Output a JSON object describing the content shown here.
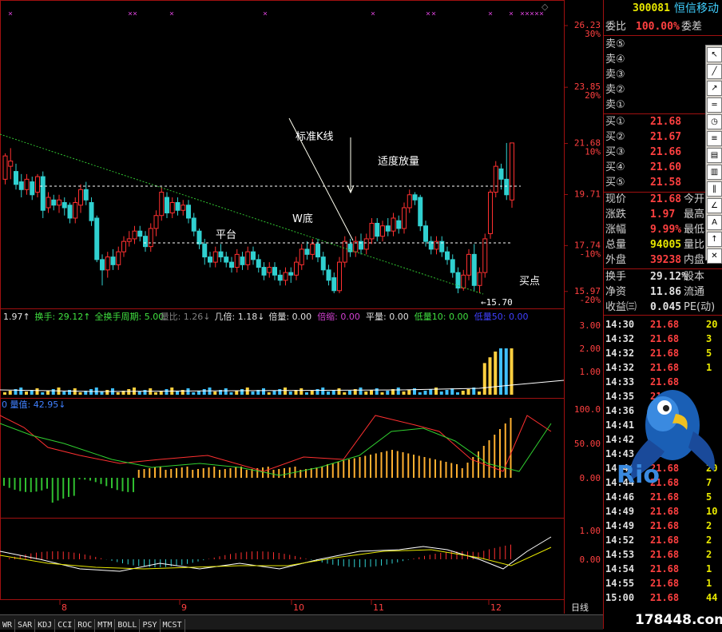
{
  "stock": {
    "code": "300081",
    "name": "恒信移动"
  },
  "order_book": {
    "weibi_label": "委比",
    "weibi_value": "100.00%",
    "weicha_label": "委差",
    "asks": [
      {
        "label": "卖⑤",
        "price": "",
        "vol": ""
      },
      {
        "label": "卖④",
        "price": "",
        "vol": ""
      },
      {
        "label": "卖③",
        "price": "",
        "vol": ""
      },
      {
        "label": "卖②",
        "price": "",
        "vol": ""
      },
      {
        "label": "卖①",
        "price": "",
        "vol": ""
      }
    ],
    "bids": [
      {
        "label": "买①",
        "price": "21.68"
      },
      {
        "label": "买②",
        "price": "21.67"
      },
      {
        "label": "买③",
        "price": "21.66"
      },
      {
        "label": "买④",
        "price": "21.60"
      },
      {
        "label": "买⑤",
        "price": "21.58"
      }
    ]
  },
  "stats": [
    {
      "label": "现价",
      "value": "21.68",
      "label2": "今开",
      "color": "red"
    },
    {
      "label": "涨跌",
      "value": "1.97",
      "label2": "最高",
      "color": "red"
    },
    {
      "label": "涨幅",
      "value": "9.99%",
      "label2": "最低",
      "color": "red"
    },
    {
      "label": "总量",
      "value": "94005",
      "label2": "量比",
      "color": "yel"
    },
    {
      "label": "外盘",
      "value": "39238",
      "label2": "内盘",
      "color": "red"
    },
    {
      "label": "换手",
      "value": "29.12%",
      "label2": "股本",
      "color": "wht"
    },
    {
      "label": "净资",
      "value": "11.86",
      "label2": "流通",
      "color": "wht"
    },
    {
      "label": "收益㈢",
      "value": "0.045",
      "label2": "PE(动)",
      "color": "wht"
    }
  ],
  "ticks": [
    {
      "time": "14:30",
      "price": "21.68",
      "vol": "20"
    },
    {
      "time": "14:32",
      "price": "21.68",
      "vol": "3"
    },
    {
      "time": "14:32",
      "price": "21.68",
      "vol": "5"
    },
    {
      "time": "14:32",
      "price": "21.68",
      "vol": "1"
    },
    {
      "time": "14:33",
      "price": "21.68",
      "vol": ""
    },
    {
      "time": "14:35",
      "price": "21.6",
      "vol": ""
    },
    {
      "time": "14:36",
      "price": "21.68",
      "vol": ""
    },
    {
      "time": "14:41",
      "price": "21.68",
      "vol": ""
    },
    {
      "time": "14:42",
      "price": "21.68",
      "vol": ""
    },
    {
      "time": "14:43",
      "price": "21.68",
      "vol": ""
    },
    {
      "time": "14:44",
      "price": "21.68",
      "vol": "20"
    },
    {
      "time": "14:44",
      "price": "21.68",
      "vol": "7"
    },
    {
      "time": "14:46",
      "price": "21.68",
      "vol": "5"
    },
    {
      "time": "14:49",
      "price": "21.68",
      "vol": "10"
    },
    {
      "time": "14:49",
      "price": "21.68",
      "vol": "2"
    },
    {
      "time": "14:52",
      "price": "21.68",
      "vol": "2"
    },
    {
      "time": "14:53",
      "price": "21.68",
      "vol": "2"
    },
    {
      "time": "14:54",
      "price": "21.68",
      "vol": "1"
    },
    {
      "time": "14:55",
      "price": "21.68",
      "vol": "1"
    },
    {
      "time": "15:00",
      "price": "21.68",
      "vol": "44"
    }
  ],
  "price_axis": [
    {
      "price": "26.23",
      "pct": "30%"
    },
    {
      "price": "23.85",
      "pct": "20%"
    },
    {
      "price": "21.68",
      "pct": "10%"
    },
    {
      "price": "19.71",
      "pct": ""
    },
    {
      "price": "17.74",
      "pct": "-10%"
    },
    {
      "price": "15.97",
      "pct": "-20%"
    }
  ],
  "annotations": {
    "standard_k": "标准K线",
    "moderate_vol": "适度放量",
    "w_bottom": "W底",
    "platform": "平台",
    "buy_point": "买点",
    "low_mark": "←15.70"
  },
  "vol_indicator": [
    {
      "text": "1.97↑",
      "color": "#e0e0e0"
    },
    {
      "text": "换手: 29.12↑",
      "color": "#40e040"
    },
    {
      "text": "全换手周期: 5.00",
      "color": "#40e040"
    },
    {
      "text": "量比: 1.26↓",
      "color": "#808080"
    },
    {
      "text": "几倍: 1.18↓",
      "color": "#e0e0e0"
    },
    {
      "text": "倍量: 0.00",
      "color": "#e0e0e0"
    },
    {
      "text": "倍缩: 0.00",
      "color": "#d040d0"
    },
    {
      "text": "平量: 0.00",
      "color": "#e0e0e0"
    },
    {
      "text": "低量10: 0.00",
      "color": "#40e040"
    },
    {
      "text": "低量50: 0.00",
      "color": "#4040ff"
    }
  ],
  "vol_axis": [
    "3.00",
    "2.00",
    "1.00"
  ],
  "ind2_label": "0 量值: 42.95↓",
  "ind2_axis": [
    "100.0",
    "50.00",
    "0.00"
  ],
  "ind3_axis": [
    "1.00",
    "0.00"
  ],
  "months": [
    "8",
    "9",
    "10",
    "11",
    "12"
  ],
  "period": "日线",
  "nav": [
    "+",
    "-",
    "0"
  ],
  "tabs": [
    "WR",
    "SAR",
    "KDJ",
    "CCI",
    "ROC",
    "MTM",
    "BOLL",
    "PSY",
    "MCST"
  ],
  "logo": "Rio",
  "watermark": "178448.com",
  "colors": {
    "up": "#ff3030",
    "down": "#30d0d0",
    "grid": "#a01010"
  },
  "chart_data": {
    "type": "candlestick",
    "y_axis": {
      "min": 15.5,
      "max": 26.6,
      "ticks": [
        26.23,
        23.85,
        21.68,
        19.71,
        17.74,
        15.97
      ]
    },
    "candles": [
      [
        20.3,
        21.2,
        21.3,
        20.1
      ],
      [
        20.8,
        21.0,
        21.5,
        20.3
      ],
      [
        20.6,
        20.1,
        20.9,
        19.9
      ],
      [
        20.2,
        19.9,
        20.5,
        19.6
      ],
      [
        19.9,
        20.3,
        20.5,
        19.7
      ],
      [
        20.2,
        19.7,
        20.4,
        19.5
      ],
      [
        19.8,
        20.4,
        20.5,
        19.6
      ],
      [
        20.4,
        19.1,
        20.6,
        18.8
      ],
      [
        19.2,
        19.6,
        19.8,
        19.0
      ],
      [
        19.5,
        19.3,
        19.7,
        19.1
      ],
      [
        19.3,
        19.5,
        19.7,
        19.0
      ],
      [
        19.4,
        19.2,
        19.6,
        18.9
      ],
      [
        19.3,
        18.8,
        19.4,
        18.6
      ],
      [
        18.8,
        19.4,
        19.6,
        18.6
      ],
      [
        19.3,
        19.9,
        20.1,
        19.0
      ],
      [
        19.9,
        19.5,
        20.2,
        19.3
      ],
      [
        19.4,
        18.7,
        19.6,
        18.5
      ],
      [
        18.8,
        17.2,
        18.9,
        17.1
      ],
      [
        17.2,
        16.8,
        17.4,
        16.2
      ],
      [
        16.8,
        17.3,
        17.5,
        16.5
      ],
      [
        17.3,
        17.0,
        17.6,
        16.8
      ],
      [
        17.0,
        17.5,
        17.7,
        16.8
      ],
      [
        17.5,
        17.9,
        18.1,
        17.3
      ],
      [
        17.9,
        18.0,
        18.3,
        17.7
      ],
      [
        18.0,
        18.3,
        18.5,
        17.8
      ],
      [
        18.3,
        18.1,
        18.5,
        17.9
      ],
      [
        18.1,
        17.7,
        18.3,
        17.5
      ],
      [
        17.7,
        18.4,
        18.6,
        17.5
      ],
      [
        18.4,
        18.9,
        19.1,
        18.1
      ],
      [
        18.9,
        19.8,
        20.0,
        18.7
      ],
      [
        19.6,
        19.0,
        19.8,
        18.8
      ],
      [
        19.0,
        19.4,
        19.6,
        18.8
      ],
      [
        19.4,
        19.1,
        19.6,
        18.9
      ],
      [
        19.1,
        19.3,
        19.5,
        18.9
      ],
      [
        19.3,
        18.8,
        19.5,
        18.6
      ],
      [
        18.8,
        18.3,
        19.0,
        18.1
      ],
      [
        18.3,
        17.8,
        18.4,
        17.6
      ],
      [
        17.8,
        17.3,
        18.0,
        17.0
      ],
      [
        17.3,
        17.1,
        17.5,
        16.9
      ],
      [
        17.1,
        17.5,
        17.7,
        16.9
      ],
      [
        17.5,
        17.3,
        17.8,
        17.1
      ],
      [
        17.3,
        17.1,
        17.5,
        16.9
      ],
      [
        17.1,
        16.9,
        17.3,
        16.7
      ],
      [
        16.9,
        17.4,
        17.6,
        16.7
      ],
      [
        17.3,
        17.0,
        17.5,
        16.8
      ],
      [
        17.0,
        17.5,
        17.7,
        16.8
      ],
      [
        17.5,
        17.2,
        17.7,
        17.0
      ],
      [
        17.2,
        16.9,
        17.4,
        16.7
      ],
      [
        16.9,
        16.6,
        17.1,
        16.4
      ],
      [
        16.7,
        16.9,
        17.1,
        16.5
      ],
      [
        16.9,
        16.6,
        17.1,
        16.4
      ],
      [
        16.6,
        16.4,
        16.8,
        16.2
      ],
      [
        16.4,
        16.7,
        16.9,
        16.2
      ],
      [
        16.7,
        16.6,
        16.9,
        16.3
      ],
      [
        16.6,
        17.1,
        17.3,
        16.4
      ],
      [
        17.0,
        17.6,
        17.8,
        16.8
      ],
      [
        17.6,
        17.4,
        17.9,
        17.2
      ],
      [
        17.4,
        17.8,
        18.0,
        17.2
      ],
      [
        17.8,
        17.3,
        18.0,
        17.1
      ],
      [
        17.3,
        16.8,
        17.5,
        16.6
      ],
      [
        16.8,
        16.4,
        17.0,
        16.2
      ],
      [
        16.5,
        16.0,
        16.7,
        15.9
      ],
      [
        16.0,
        17.1,
        17.3,
        15.9
      ],
      [
        17.1,
        17.9,
        18.1,
        16.9
      ],
      [
        17.8,
        17.5,
        18.0,
        17.3
      ],
      [
        17.5,
        17.9,
        18.1,
        17.3
      ],
      [
        17.9,
        17.6,
        18.2,
        17.4
      ],
      [
        17.6,
        18.0,
        18.2,
        17.4
      ],
      [
        18.0,
        18.6,
        18.8,
        17.8
      ],
      [
        18.6,
        18.1,
        18.8,
        17.9
      ],
      [
        18.1,
        18.5,
        18.7,
        17.9
      ],
      [
        18.5,
        18.3,
        18.8,
        18.1
      ],
      [
        18.3,
        18.8,
        19.0,
        18.1
      ],
      [
        18.7,
        18.4,
        18.9,
        18.2
      ],
      [
        18.4,
        19.2,
        19.4,
        18.2
      ],
      [
        19.2,
        19.7,
        19.9,
        19.0
      ],
      [
        19.7,
        19.5,
        19.8,
        19.3
      ],
      [
        19.6,
        18.5,
        19.7,
        18.3
      ],
      [
        18.5,
        17.9,
        18.7,
        17.7
      ],
      [
        17.9,
        17.6,
        18.1,
        17.4
      ],
      [
        17.6,
        17.9,
        18.1,
        17.4
      ],
      [
        17.9,
        17.5,
        18.1,
        17.3
      ],
      [
        17.5,
        17.2,
        17.7,
        17.0
      ],
      [
        17.2,
        16.7,
        17.4,
        16.5
      ],
      [
        16.7,
        16.1,
        16.9,
        15.9
      ],
      [
        16.1,
        16.6,
        16.8,
        16.0
      ],
      [
        16.6,
        17.4,
        17.6,
        16.4
      ],
      [
        17.4,
        16.2,
        17.8,
        16.0
      ],
      [
        16.2,
        16.7,
        16.9,
        15.9
      ],
      [
        16.7,
        18.0,
        18.2,
        16.5
      ],
      [
        18.2,
        19.8,
        19.9,
        18.0
      ],
      [
        19.8,
        20.8,
        21.0,
        19.6
      ],
      [
        20.7,
        20.3,
        20.9,
        19.9
      ],
      [
        20.3,
        19.7,
        21.7,
        19.5
      ],
      [
        19.5,
        21.7,
        21.7,
        19.2
      ]
    ]
  }
}
